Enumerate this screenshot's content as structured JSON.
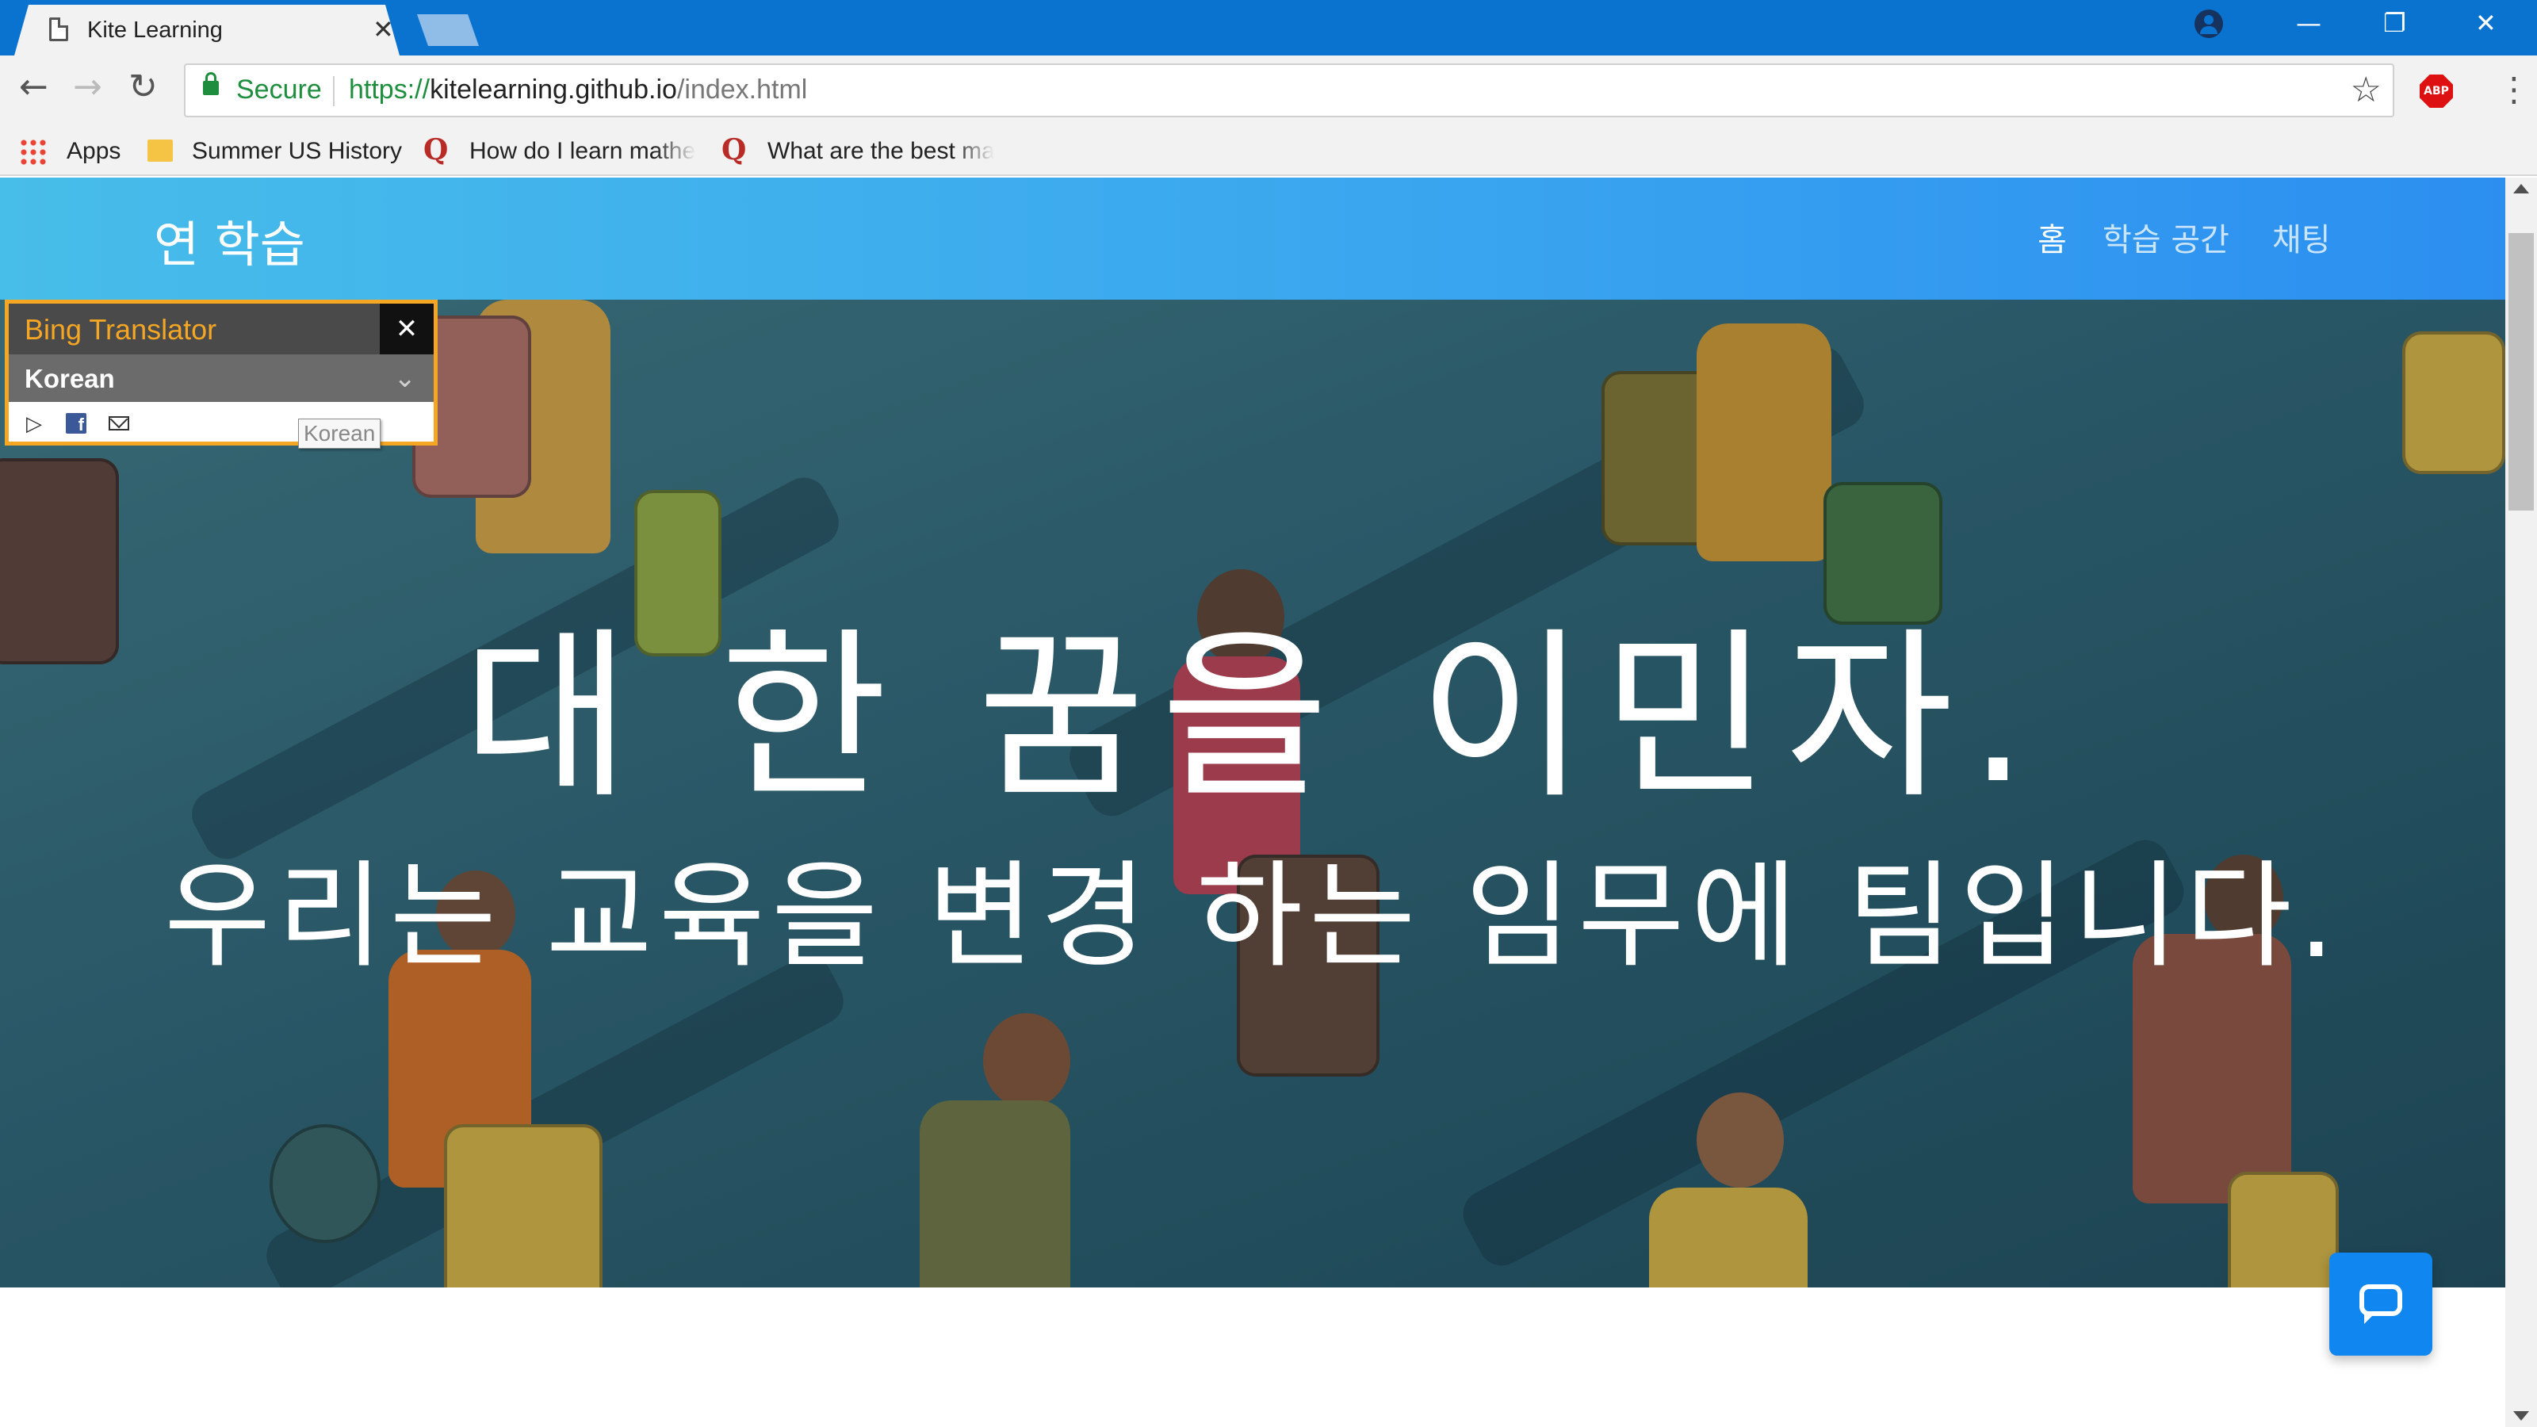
{
  "browser": {
    "tab_title": "Kite Learning",
    "tab_close": "✕",
    "window_controls": {
      "minimize": "—",
      "restore": "❐",
      "close": "✕"
    },
    "nav": {
      "back": "←",
      "forward": "→",
      "reload": "↻"
    },
    "address": {
      "security_label": "Secure",
      "url_scheme": "https://",
      "url_host": "kitelearning.github.io",
      "url_path": "/index.html"
    },
    "star": "☆",
    "abp_label": "ABP",
    "menu": "⋮",
    "bookmarks": [
      {
        "label": "Apps",
        "icon": "apps-grid-icon"
      },
      {
        "label": "Summer US History",
        "icon": "folder-icon"
      },
      {
        "label": "How do I learn mathe",
        "icon": "quora-icon"
      },
      {
        "label": "What are the best ma",
        "icon": "quora-icon"
      }
    ],
    "quora_glyph": "Q"
  },
  "site": {
    "brand": "연 학습",
    "nav_links": [
      {
        "label": "홈",
        "active": true
      },
      {
        "label": "학습 공간",
        "active": false
      },
      {
        "label": "채팅",
        "active": false
      }
    ],
    "hero": {
      "headline": "대 한 꿈을 이민자.",
      "subline": "우리는 교육을 변경 하는 임무에 팀입니다."
    }
  },
  "translator": {
    "title": "Bing Translator",
    "close": "✕",
    "language": "Korean",
    "chevron": "⌄",
    "play": "▷",
    "fb": "f",
    "tooltip": "Korean"
  },
  "colors": {
    "chrome_blue": "#0a73d0",
    "nav_gradient_start": "#47bde9",
    "nav_gradient_end": "#2c8ff0",
    "bing_accent": "#f5a623",
    "chat_button": "#0f86f0"
  }
}
